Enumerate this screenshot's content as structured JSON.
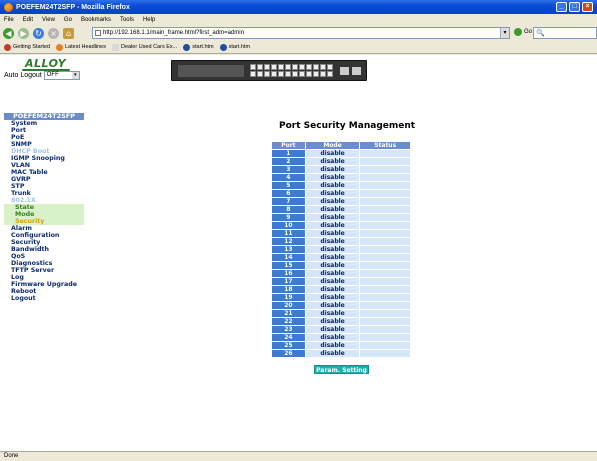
{
  "window": {
    "title": "POEFEM24T2SFP - Mozilla Firefox"
  },
  "menu": [
    "File",
    "Edit",
    "View",
    "Go",
    "Bookmarks",
    "Tools",
    "Help"
  ],
  "address": {
    "url": "http://192.168.1.1/main_frame.html?first_adm=admin"
  },
  "go_label": "Go",
  "bookmarks": [
    {
      "label": "Getting Started",
      "color": "#c0392b"
    },
    {
      "label": "Latest Headlines",
      "color": "#e67e22"
    },
    {
      "label": "Dealer Used Cars Ex...",
      "color": "#d9d9d9"
    },
    {
      "label": "start.htm",
      "color": "#1f4e9c"
    },
    {
      "label": "start.htm",
      "color": "#1f4e9c"
    }
  ],
  "status_bar": "Done",
  "brand": {
    "logo": "ALLOY"
  },
  "auto_logout": {
    "label": "Auto Logout",
    "value": "OFF"
  },
  "sidebar": {
    "title": "POEFEM24T2SFP",
    "items": [
      {
        "label": "System",
        "type": "item"
      },
      {
        "label": "Port",
        "type": "item"
      },
      {
        "label": "PoE",
        "type": "item"
      },
      {
        "label": "SNMP",
        "type": "item"
      },
      {
        "label": "DHCP Boot",
        "type": "sec"
      },
      {
        "label": "IGMP Snooping",
        "type": "item"
      },
      {
        "label": "VLAN",
        "type": "item"
      },
      {
        "label": "MAC Table",
        "type": "item"
      },
      {
        "label": "GVRP",
        "type": "item"
      },
      {
        "label": "STP",
        "type": "item"
      },
      {
        "label": "Trunk",
        "type": "item"
      },
      {
        "label": "802.1X",
        "type": "sec"
      },
      {
        "label": "State",
        "type": "sub"
      },
      {
        "label": "Mode",
        "type": "sub"
      },
      {
        "label": "Security",
        "type": "subhi"
      },
      {
        "label": "Alarm",
        "type": "item"
      },
      {
        "label": "Configuration",
        "type": "item"
      },
      {
        "label": "Security",
        "type": "item"
      },
      {
        "label": "Bandwidth",
        "type": "item"
      },
      {
        "label": "QoS",
        "type": "item"
      },
      {
        "label": "Diagnostics",
        "type": "item"
      },
      {
        "label": "TFTP Server",
        "type": "item"
      },
      {
        "label": "Log",
        "type": "item"
      },
      {
        "label": "Firmware Upgrade",
        "type": "item"
      },
      {
        "label": "Reboot",
        "type": "item"
      },
      {
        "label": "Logout",
        "type": "item"
      }
    ]
  },
  "main": {
    "title": "Port Security Management",
    "columns": [
      "Port",
      "Mode",
      "Status"
    ],
    "rows": [
      {
        "port": "1",
        "mode": "disable",
        "status": ""
      },
      {
        "port": "2",
        "mode": "disable",
        "status": ""
      },
      {
        "port": "3",
        "mode": "disable",
        "status": ""
      },
      {
        "port": "4",
        "mode": "disable",
        "status": ""
      },
      {
        "port": "5",
        "mode": "disable",
        "status": ""
      },
      {
        "port": "6",
        "mode": "disable",
        "status": ""
      },
      {
        "port": "7",
        "mode": "disable",
        "status": ""
      },
      {
        "port": "8",
        "mode": "disable",
        "status": ""
      },
      {
        "port": "9",
        "mode": "disable",
        "status": ""
      },
      {
        "port": "10",
        "mode": "disable",
        "status": ""
      },
      {
        "port": "11",
        "mode": "disable",
        "status": ""
      },
      {
        "port": "12",
        "mode": "disable",
        "status": ""
      },
      {
        "port": "13",
        "mode": "disable",
        "status": ""
      },
      {
        "port": "14",
        "mode": "disable",
        "status": ""
      },
      {
        "port": "15",
        "mode": "disable",
        "status": ""
      },
      {
        "port": "16",
        "mode": "disable",
        "status": ""
      },
      {
        "port": "17",
        "mode": "disable",
        "status": ""
      },
      {
        "port": "18",
        "mode": "disable",
        "status": ""
      },
      {
        "port": "19",
        "mode": "disable",
        "status": ""
      },
      {
        "port": "20",
        "mode": "disable",
        "status": ""
      },
      {
        "port": "21",
        "mode": "disable",
        "status": ""
      },
      {
        "port": "22",
        "mode": "disable",
        "status": ""
      },
      {
        "port": "23",
        "mode": "disable",
        "status": ""
      },
      {
        "port": "24",
        "mode": "disable",
        "status": ""
      },
      {
        "port": "25",
        "mode": "disable",
        "status": ""
      },
      {
        "port": "26",
        "mode": "disable",
        "status": ""
      }
    ],
    "button": "Param. Setting"
  }
}
